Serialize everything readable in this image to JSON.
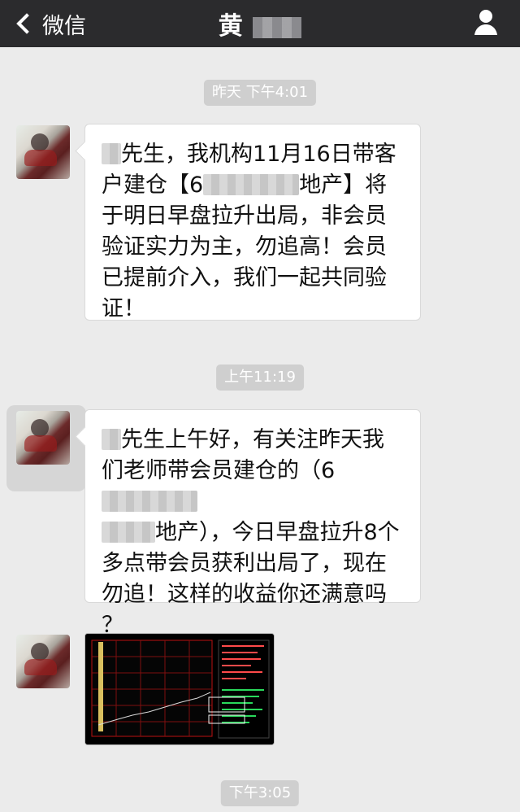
{
  "header": {
    "back_label": "微信",
    "title": "黄"
  },
  "timestamps": {
    "t1": "昨天 下午4:01",
    "t2": "上午11:19",
    "t3": "下午3:05"
  },
  "messages": [
    {
      "p1": "先生，我机构11月16日带客",
      "p2_prefix": "户建仓【6",
      "p2_suffix": "地产】将",
      "p3": "于明日早盘拉升出局，非会员",
      "p4": "验证实力为主，勿追高！会员",
      "p5": "已提前介入，我们一起共同验",
      "p6": "证！"
    },
    {
      "p1": "先生上午好，有关注昨天我",
      "p2": "们老师带会员建仓的（6",
      "p3_suffix": "地产），今日早盘拉升8个",
      "p4": "多点带会员获利出局了，现在",
      "p5": "勿追！这样的收益你还满意吗",
      "p6": "？"
    }
  ],
  "icons": {
    "back": "chevron-left-icon",
    "profile": "person-icon"
  },
  "colors": {
    "header_bg": "#2b2b2d",
    "chat_bg": "#ebebeb",
    "bubble_bg": "#ffffff",
    "timestamp_bg": "#cfcfcf"
  }
}
